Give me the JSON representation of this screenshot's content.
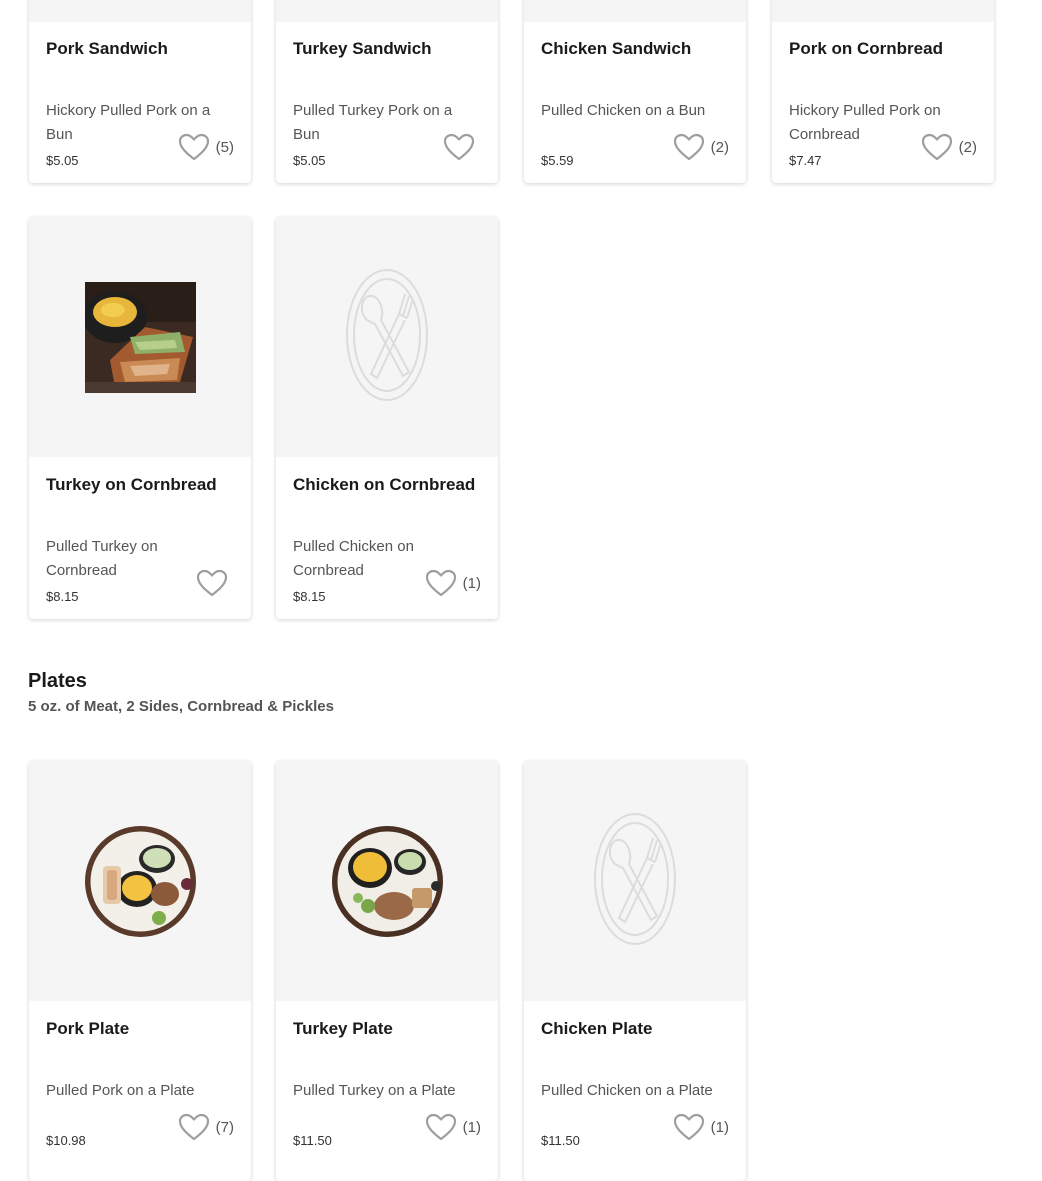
{
  "sandwiches_top": [
    {
      "name": "Pork Sandwich",
      "desc": "Hickory Pulled Pork on a Bun",
      "price": "$5.05",
      "count": "(5)"
    },
    {
      "name": "Turkey Sandwich",
      "desc": "Pulled Turkey Pork on a Bun",
      "price": "$5.05",
      "count": ""
    },
    {
      "name": "Chicken Sandwich",
      "desc": "Pulled Chicken on a Bun",
      "price": "$5.59",
      "count": "(2)"
    },
    {
      "name": "Pork on Cornbread",
      "desc": "Hickory Pulled Pork on Cornbread",
      "price": "$7.47",
      "count": "(2)"
    }
  ],
  "sandwiches_second": [
    {
      "name": "Turkey on Cornbread",
      "desc": "Pulled Turkey on Cornbread",
      "price": "$8.15",
      "count": "",
      "image": "turkey-cornbread-photo"
    },
    {
      "name": "Chicken on Cornbread",
      "desc": "Pulled Chicken on Cornbread",
      "price": "$8.15",
      "count": "(1)",
      "image": "placeholder-plate-icon"
    }
  ],
  "plates_section": {
    "title": "Plates",
    "subtitle": "5 oz. of Meat, 2 Sides, Cornbread & Pickles",
    "items": [
      {
        "name": "Pork Plate",
        "desc": "Pulled Pork on a Plate",
        "price": "$10.98",
        "count": "(7)",
        "image": "pork-plate-photo"
      },
      {
        "name": "Turkey Plate",
        "desc": "Pulled Turkey on a Plate",
        "price": "$11.50",
        "count": "(1)",
        "image": "turkey-plate-photo"
      },
      {
        "name": "Chicken Plate",
        "desc": "Pulled Chicken on a Plate",
        "price": "$11.50",
        "count": "(1)",
        "image": "placeholder-plate-icon"
      }
    ]
  },
  "icons": {
    "favorite": "heart-outline-icon",
    "placeholder": "plate-fork-knife-icon"
  },
  "colors": {
    "card_bg": "#ffffff",
    "image_bg": "#f5f5f5",
    "heart": "#9e9e9e",
    "text": "#1a1a1a",
    "muted": "#555555"
  }
}
